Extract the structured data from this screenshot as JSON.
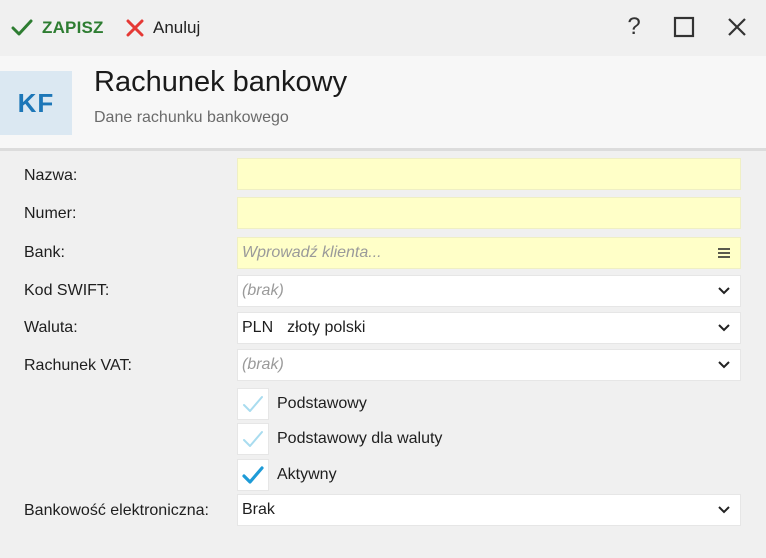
{
  "toolbar": {
    "save_label": "ZAPISZ",
    "cancel_label": "Anuluj",
    "help_label": "?"
  },
  "header": {
    "logo_text": "KF",
    "title": "Rachunek bankowy",
    "subtitle": "Dane rachunku bankowego"
  },
  "form": {
    "nazwa": {
      "label": "Nazwa:",
      "value": ""
    },
    "numer": {
      "label": "Numer:",
      "value": ""
    },
    "bank": {
      "label": "Bank:",
      "value": "",
      "placeholder": "Wprowadź klienta..."
    },
    "kod_swift": {
      "label": "Kod SWIFT:",
      "value": "(brak)"
    },
    "waluta": {
      "label": "Waluta:",
      "code": "PLN",
      "name": "złoty polski"
    },
    "rachunek_vat": {
      "label": "Rachunek VAT:",
      "value": "(brak)"
    },
    "checkboxes": [
      {
        "label": "Podstawowy",
        "checked": false
      },
      {
        "label": "Podstawowy dla waluty",
        "checked": false
      },
      {
        "label": "Aktywny",
        "checked": true
      }
    ],
    "bankowosc": {
      "label": "Bankowość elektroniczna:",
      "value": "Brak"
    }
  },
  "colors": {
    "accent_green": "#2e7d32",
    "cancel_red": "#e53935",
    "required_field": "#ffffc8",
    "logo_blue": "#1d77b8",
    "check_blue": "#1e9bd7"
  }
}
